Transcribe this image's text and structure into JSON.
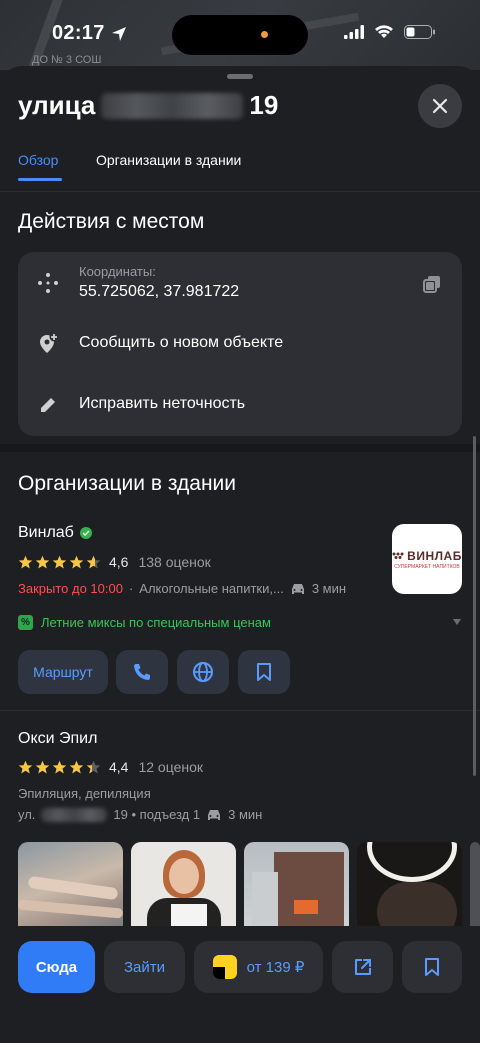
{
  "status": {
    "time": "02:17"
  },
  "map": {
    "label": "ДО № 3 СОШ"
  },
  "header": {
    "title_prefix": "улица",
    "title_suffix": "19"
  },
  "tabs": [
    {
      "label": "Обзор",
      "active": true
    },
    {
      "label": "Организации в здании",
      "active": false
    }
  ],
  "actions": {
    "title": "Действия с местом",
    "coord_label": "Координаты:",
    "coord_value": "55.725062, 37.981722",
    "report_label": "Сообщить о новом объекте",
    "fix_label": "Исправить неточность"
  },
  "orgs_section": {
    "title": "Организации в здании"
  },
  "org1": {
    "name": "Винлаб",
    "rating": "4,6",
    "rating_value": 4.6,
    "reviews": "138 оценок",
    "status": "Закрыто до 10:00",
    "category": "Алкогольные напитки,...",
    "drive_time": "3 мин",
    "promo": "Летние миксы по специальным ценам",
    "logo_text": "ВИНЛАБ",
    "logo_sub": "СУПЕРМАРКЕТ НАПИТКОВ",
    "route_label": "Маршрут"
  },
  "org2": {
    "name": "Окси Эпил",
    "rating": "4,4",
    "rating_value": 4.4,
    "reviews": "12 оценок",
    "category": "Эпиляция, депиляция",
    "address_prefix": "ул.",
    "address_suffix": "19 • подъезд 1",
    "drive_time": "3 мин"
  },
  "bottom": {
    "here_label": "Сюда",
    "enter_label": "Зайти",
    "taxi_label": "от 139 ₽"
  },
  "colors": {
    "accent": "#4a8cff",
    "primary_button": "#2f7cf6",
    "closed": "#ff4f4f",
    "promo": "#39c55a",
    "star": "#f6c744"
  }
}
